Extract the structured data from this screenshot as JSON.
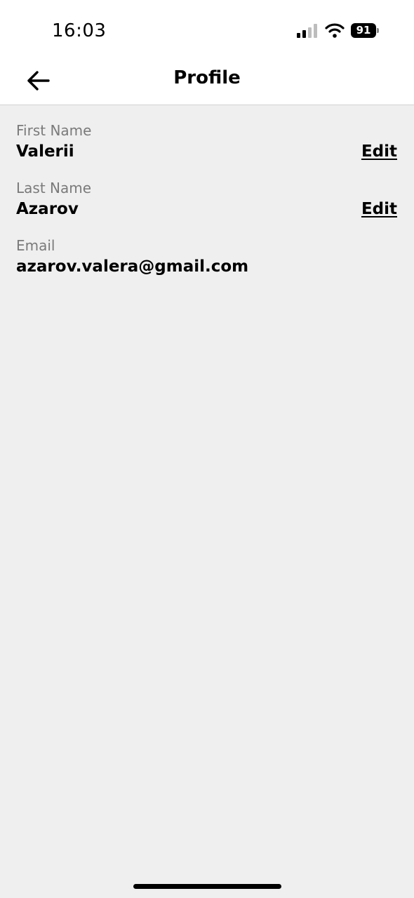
{
  "status_bar": {
    "time": "16:03",
    "battery_level": "91",
    "signal_icon": "cellular-signal-icon",
    "wifi_icon": "wifi-icon"
  },
  "nav": {
    "back_icon": "arrow-left-icon",
    "title": "Profile"
  },
  "fields": [
    {
      "label": "First Name",
      "value": "Valerii",
      "action": "Edit"
    },
    {
      "label": "Last Name",
      "value": "Azarov",
      "action": "Edit"
    },
    {
      "label": "Email",
      "value": "azarov.valera@gmail.com"
    }
  ],
  "colors": {
    "background": "#efefef",
    "header_background": "#ffffff",
    "label": "#7a7a7a",
    "text": "#000000"
  }
}
